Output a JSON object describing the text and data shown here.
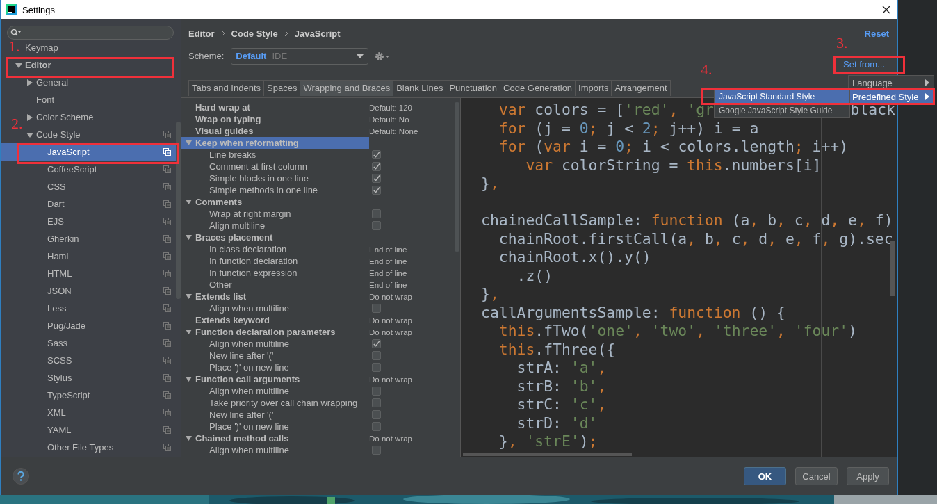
{
  "window": {
    "title": "Settings"
  },
  "tree": [
    {
      "label": "Keymap",
      "selected": false
    },
    {
      "label": "Editor",
      "expanded": true,
      "selected": false,
      "children": [
        {
          "label": "General",
          "expanded": false,
          "selected": false
        },
        {
          "label": "Font",
          "selected": false
        },
        {
          "label": "Color Scheme",
          "expanded": false,
          "selected": false
        },
        {
          "label": "Code Style",
          "expanded": true,
          "selected": false,
          "children": [
            {
              "label": "JavaScript",
              "selected": true
            },
            {
              "label": "CoffeeScript",
              "selected": false
            },
            {
              "label": "CSS",
              "selected": false
            },
            {
              "label": "Dart",
              "selected": false
            },
            {
              "label": "EJS",
              "selected": false
            },
            {
              "label": "Gherkin",
              "selected": false
            },
            {
              "label": "Haml",
              "selected": false
            },
            {
              "label": "HTML",
              "selected": false
            },
            {
              "label": "JSON",
              "selected": false
            },
            {
              "label": "Less",
              "selected": false
            },
            {
              "label": "Pug/Jade",
              "selected": false
            },
            {
              "label": "Sass",
              "selected": false
            },
            {
              "label": "SCSS",
              "selected": false
            },
            {
              "label": "Stylus",
              "selected": false
            },
            {
              "label": "TypeScript",
              "selected": false
            },
            {
              "label": "XML",
              "selected": false
            },
            {
              "label": "YAML",
              "selected": false
            },
            {
              "label": "Other File Types",
              "selected": false
            }
          ]
        }
      ]
    }
  ],
  "breadcrumb": [
    "Editor",
    "Code Style",
    "JavaScript"
  ],
  "reset_link": "Reset",
  "scheme": {
    "label": "Scheme:",
    "value": "Default",
    "qualifier": "IDE"
  },
  "set_from_link": "Set from...",
  "tabs": [
    {
      "label": "Tabs and Indents",
      "selected": false
    },
    {
      "label": "Spaces",
      "selected": false
    },
    {
      "label": "Wrapping and Braces",
      "selected": true
    },
    {
      "label": "Blank Lines",
      "selected": false
    },
    {
      "label": "Punctuation",
      "selected": false
    },
    {
      "label": "Code Generation",
      "selected": false
    },
    {
      "label": "Imports",
      "selected": false
    },
    {
      "label": "Arrangement",
      "selected": false
    }
  ],
  "options": [
    {
      "kind": "heading",
      "label": "Hard wrap at",
      "value": "Default: 120",
      "selected": false
    },
    {
      "kind": "heading",
      "label": "Wrap on typing",
      "value": "Default: No",
      "selected": false
    },
    {
      "kind": "heading",
      "label": "Visual guides",
      "value": "Default: None",
      "selected": false
    },
    {
      "kind": "group",
      "label": "Keep when reformatting",
      "expanded": true,
      "selected": true
    },
    {
      "kind": "check",
      "label": "Line breaks",
      "checked": true,
      "selected": false
    },
    {
      "kind": "check",
      "label": "Comment at first column",
      "checked": true,
      "selected": false
    },
    {
      "kind": "check",
      "label": "Simple blocks in one line",
      "checked": true,
      "selected": false
    },
    {
      "kind": "check",
      "label": "Simple methods in one line",
      "checked": true,
      "selected": false
    },
    {
      "kind": "group",
      "label": "Comments",
      "expanded": true,
      "selected": false
    },
    {
      "kind": "check",
      "label": "Wrap at right margin",
      "checked": false,
      "selected": false
    },
    {
      "kind": "check",
      "label": "Align multiline",
      "checked": false,
      "selected": false
    },
    {
      "kind": "group",
      "label": "Braces placement",
      "expanded": true,
      "selected": false
    },
    {
      "kind": "option",
      "label": "In class declaration",
      "value": "End of line",
      "selected": false
    },
    {
      "kind": "option",
      "label": "In function declaration",
      "value": "End of line",
      "selected": false
    },
    {
      "kind": "option",
      "label": "In function expression",
      "value": "End of line",
      "selected": false
    },
    {
      "kind": "option",
      "label": "Other",
      "value": "End of line",
      "selected": false
    },
    {
      "kind": "group",
      "label": "Extends list",
      "expanded": true,
      "value": "Do not wrap",
      "selected": false
    },
    {
      "kind": "check",
      "label": "Align when multiline",
      "checked": false,
      "selected": false
    },
    {
      "kind": "heading",
      "label": "Extends keyword",
      "value": "Do not wrap",
      "selected": false
    },
    {
      "kind": "group",
      "label": "Function declaration parameters",
      "expanded": true,
      "value": "Do not wrap",
      "selected": false
    },
    {
      "kind": "check",
      "label": "Align when multiline",
      "checked": true,
      "selected": false
    },
    {
      "kind": "check",
      "label": "New line after '('",
      "checked": false,
      "selected": false
    },
    {
      "kind": "check",
      "label": "Place ')' on new line",
      "checked": false,
      "selected": false
    },
    {
      "kind": "group",
      "label": "Function call arguments",
      "expanded": true,
      "value": "Do not wrap",
      "selected": false
    },
    {
      "kind": "check",
      "label": "Align when multiline",
      "checked": false,
      "selected": false
    },
    {
      "kind": "check",
      "label": "Take priority over call chain wrapping",
      "checked": false,
      "selected": false
    },
    {
      "kind": "check",
      "label": "New line after '('",
      "checked": false,
      "selected": false
    },
    {
      "kind": "check",
      "label": "Place ')' on new line",
      "checked": false,
      "selected": false
    },
    {
      "kind": "group",
      "label": "Chained method calls",
      "expanded": true,
      "value": "Do not wrap",
      "selected": false
    },
    {
      "kind": "check",
      "label": "Align when multiline",
      "checked": false,
      "selected": false
    }
  ],
  "code": [
    {
      "kind": "code",
      "tokens": [
        {
          "kind": "keyword",
          "text": "  var"
        },
        {
          "kind": "plain",
          "text": " colors = ["
        },
        {
          "kind": "string",
          "text": "'red'"
        },
        {
          "kind": "punct",
          "text": ", "
        },
        {
          "kind": "string",
          "text": "'gr"
        }
      ],
      "tail": [
        {
          "kind": "plain",
          "text": "black"
        }
      ]
    },
    {
      "kind": "code",
      "tokens": [
        {
          "kind": "keyword",
          "text": "  for"
        },
        {
          "kind": "plain",
          "text": " (j = "
        },
        {
          "kind": "number",
          "text": "0"
        },
        {
          "kind": "punct",
          "text": "; "
        },
        {
          "kind": "plain",
          "text": "j < "
        },
        {
          "kind": "number",
          "text": "2"
        },
        {
          "kind": "punct",
          "text": "; "
        },
        {
          "kind": "plain",
          "text": "j++) i = a"
        }
      ]
    },
    {
      "kind": "code",
      "tokens": [
        {
          "kind": "keyword",
          "text": "  for"
        },
        {
          "kind": "plain",
          "text": " ("
        },
        {
          "kind": "keyword",
          "text": "var"
        },
        {
          "kind": "plain",
          "text": " i = "
        },
        {
          "kind": "number",
          "text": "0"
        },
        {
          "kind": "punct",
          "text": "; "
        },
        {
          "kind": "plain",
          "text": "i < colors.length"
        },
        {
          "kind": "punct",
          "text": "; "
        },
        {
          "kind": "plain",
          "text": "i++)"
        }
      ]
    },
    {
      "kind": "code",
      "tokens": [
        {
          "kind": "keyword",
          "text": "     var"
        },
        {
          "kind": "plain",
          "text": " colorString = "
        },
        {
          "kind": "keyword",
          "text": "this"
        },
        {
          "kind": "plain",
          "text": ".numbers[i]"
        }
      ]
    },
    {
      "kind": "code",
      "tokens": [
        {
          "kind": "plain",
          "text": "}"
        },
        {
          "kind": "punct",
          "text": ","
        }
      ]
    },
    {
      "kind": "blank"
    },
    {
      "kind": "code",
      "tokens": [
        {
          "kind": "plain",
          "text": "chainedCallSample: "
        },
        {
          "kind": "keyword",
          "text": "function"
        },
        {
          "kind": "plain",
          "text": " (a"
        },
        {
          "kind": "punct",
          "text": ", "
        },
        {
          "kind": "plain",
          "text": "b"
        },
        {
          "kind": "punct",
          "text": ", "
        },
        {
          "kind": "plain",
          "text": "c"
        },
        {
          "kind": "punct",
          "text": ", "
        },
        {
          "kind": "plain",
          "text": "d"
        },
        {
          "kind": "punct",
          "text": ", "
        },
        {
          "kind": "plain",
          "text": "e"
        },
        {
          "kind": "punct",
          "text": ", "
        },
        {
          "kind": "plain",
          "text": "f)"
        }
      ]
    },
    {
      "kind": "code",
      "tokens": [
        {
          "kind": "plain",
          "text": "  chainRoot.firstCall(a"
        },
        {
          "kind": "punct",
          "text": ", "
        },
        {
          "kind": "plain",
          "text": "b"
        },
        {
          "kind": "punct",
          "text": ", "
        },
        {
          "kind": "plain",
          "text": "c"
        },
        {
          "kind": "punct",
          "text": ", "
        },
        {
          "kind": "plain",
          "text": "d"
        },
        {
          "kind": "punct",
          "text": ", "
        },
        {
          "kind": "plain",
          "text": "e"
        },
        {
          "kind": "punct",
          "text": ", "
        },
        {
          "kind": "plain",
          "text": "f"
        },
        {
          "kind": "punct",
          "text": ", "
        },
        {
          "kind": "plain",
          "text": "g).sec"
        }
      ]
    },
    {
      "kind": "code",
      "tokens": [
        {
          "kind": "plain",
          "text": "  chainRoot.x().y()"
        }
      ]
    },
    {
      "kind": "code",
      "tokens": [
        {
          "kind": "plain",
          "text": "    .z()"
        }
      ]
    },
    {
      "kind": "code",
      "tokens": [
        {
          "kind": "plain",
          "text": "}"
        },
        {
          "kind": "punct",
          "text": ","
        }
      ]
    },
    {
      "kind": "code",
      "tokens": [
        {
          "kind": "plain",
          "text": "callArgumentsSample: "
        },
        {
          "kind": "keyword",
          "text": "function"
        },
        {
          "kind": "plain",
          "text": " () {"
        }
      ]
    },
    {
      "kind": "code",
      "tokens": [
        {
          "kind": "keyword",
          "text": "  this"
        },
        {
          "kind": "plain",
          "text": ".fTwo("
        },
        {
          "kind": "string",
          "text": "'one'"
        },
        {
          "kind": "punct",
          "text": ", "
        },
        {
          "kind": "string",
          "text": "'two'"
        },
        {
          "kind": "punct",
          "text": ", "
        },
        {
          "kind": "string",
          "text": "'three'"
        },
        {
          "kind": "punct",
          "text": ", "
        },
        {
          "kind": "string",
          "text": "'four'"
        },
        {
          "kind": "plain",
          "text": ")"
        }
      ]
    },
    {
      "kind": "code",
      "tokens": [
        {
          "kind": "keyword",
          "text": "  this"
        },
        {
          "kind": "plain",
          "text": ".fThree({"
        }
      ]
    },
    {
      "kind": "code",
      "tokens": [
        {
          "kind": "plain",
          "text": "    strA: "
        },
        {
          "kind": "string",
          "text": "'a'"
        },
        {
          "kind": "punct",
          "text": ","
        }
      ]
    },
    {
      "kind": "code",
      "tokens": [
        {
          "kind": "plain",
          "text": "    strB: "
        },
        {
          "kind": "string",
          "text": "'b'"
        },
        {
          "kind": "punct",
          "text": ","
        }
      ]
    },
    {
      "kind": "code",
      "tokens": [
        {
          "kind": "plain",
          "text": "    strC: "
        },
        {
          "kind": "string",
          "text": "'c'"
        },
        {
          "kind": "punct",
          "text": ","
        }
      ]
    },
    {
      "kind": "code",
      "tokens": [
        {
          "kind": "plain",
          "text": "    strD: "
        },
        {
          "kind": "string",
          "text": "'d'"
        }
      ]
    },
    {
      "kind": "code",
      "tokens": [
        {
          "kind": "plain",
          "text": "  }"
        },
        {
          "kind": "punct",
          "text": ", "
        },
        {
          "kind": "string",
          "text": "'strE'"
        },
        {
          "kind": "plain",
          "text": ")"
        },
        {
          "kind": "punct",
          "text": ";"
        }
      ]
    }
  ],
  "menu": [
    {
      "label": "Language",
      "selected": false
    },
    {
      "label": "Predefined Style",
      "selected": true
    }
  ],
  "submenu": [
    {
      "label": "JavaScript Standard Style",
      "selected": true
    },
    {
      "label": "Google JavaScript Style Guide",
      "selected": false
    }
  ],
  "buttons": [
    {
      "label": "OK",
      "default": true
    },
    {
      "label": "Cancel",
      "default": false
    },
    {
      "label": "Apply",
      "default": false
    }
  ],
  "annotations": [
    {
      "label": "1."
    },
    {
      "label": "2."
    },
    {
      "label": "3."
    },
    {
      "label": "4."
    }
  ]
}
